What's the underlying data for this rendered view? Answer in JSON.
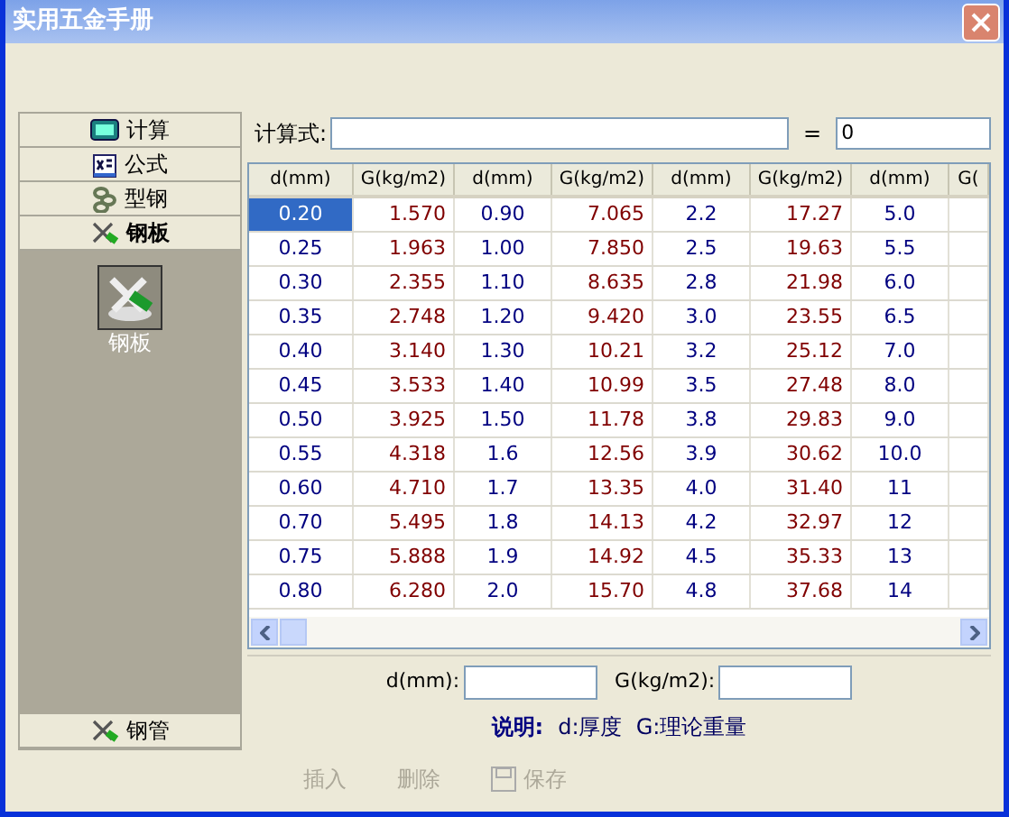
{
  "window": {
    "title": "实用五金手册"
  },
  "sidebar": {
    "sections": [
      {
        "label": "计算",
        "kind": "calculator",
        "expanded": false
      },
      {
        "label": "公式",
        "kind": "formula",
        "expanded": false
      },
      {
        "label": "型钢",
        "kind": "chain",
        "expanded": false
      },
      {
        "label": "钢板",
        "kind": "tools",
        "expanded": true,
        "items": [
          {
            "label": "钢板",
            "selected": true
          }
        ]
      },
      {
        "label": "钢管",
        "kind": "tools",
        "expanded": false
      }
    ]
  },
  "formula": {
    "label": "计算式:",
    "equals": "=",
    "result": "0"
  },
  "table": {
    "columns": [
      "d(mm)",
      "G(kg/m2)",
      "d(mm)",
      "G(kg/m2)",
      "d(mm)",
      "G(kg/m2)",
      "d(mm)",
      "G("
    ],
    "rows": [
      {
        "selected": true,
        "cells": [
          "0.20",
          "1.570",
          "0.90",
          "7.065",
          "2.2",
          "17.27",
          "5.0"
        ]
      },
      {
        "selected": false,
        "cells": [
          "0.25",
          "1.963",
          "1.00",
          "7.850",
          "2.5",
          "19.63",
          "5.5"
        ]
      },
      {
        "selected": false,
        "cells": [
          "0.30",
          "2.355",
          "1.10",
          "8.635",
          "2.8",
          "21.98",
          "6.0"
        ]
      },
      {
        "selected": false,
        "cells": [
          "0.35",
          "2.748",
          "1.20",
          "9.420",
          "3.0",
          "23.55",
          "6.5"
        ]
      },
      {
        "selected": false,
        "cells": [
          "0.40",
          "3.140",
          "1.30",
          "10.21",
          "3.2",
          "25.12",
          "7.0"
        ]
      },
      {
        "selected": false,
        "cells": [
          "0.45",
          "3.533",
          "1.40",
          "10.99",
          "3.5",
          "27.48",
          "8.0"
        ]
      },
      {
        "selected": false,
        "cells": [
          "0.50",
          "3.925",
          "1.50",
          "11.78",
          "3.8",
          "29.83",
          "9.0"
        ]
      },
      {
        "selected": false,
        "cells": [
          "0.55",
          "4.318",
          "1.6",
          "12.56",
          "3.9",
          "30.62",
          "10.0"
        ]
      },
      {
        "selected": false,
        "cells": [
          "0.60",
          "4.710",
          "1.7",
          "13.35",
          "4.0",
          "31.40",
          "11"
        ]
      },
      {
        "selected": false,
        "cells": [
          "0.70",
          "5.495",
          "1.8",
          "14.13",
          "4.2",
          "32.97",
          "12"
        ]
      },
      {
        "selected": false,
        "cells": [
          "0.75",
          "5.888",
          "1.9",
          "14.92",
          "4.5",
          "35.33",
          "13"
        ]
      },
      {
        "selected": false,
        "cells": [
          "0.80",
          "6.280",
          "2.0",
          "15.70",
          "4.8",
          "37.68",
          "14"
        ]
      }
    ]
  },
  "fields": [
    {
      "label": "d(mm):"
    },
    {
      "label": "G(kg/m2):"
    }
  ],
  "note": {
    "label": "说明:",
    "text": "d:厚度  G:理论重量"
  },
  "buttons": [
    {
      "label": "插入",
      "kind": "plain",
      "disabled": true
    },
    {
      "label": "删除",
      "kind": "plain",
      "disabled": true
    },
    {
      "label": "保存",
      "kind": "disk",
      "disabled": true
    }
  ]
}
